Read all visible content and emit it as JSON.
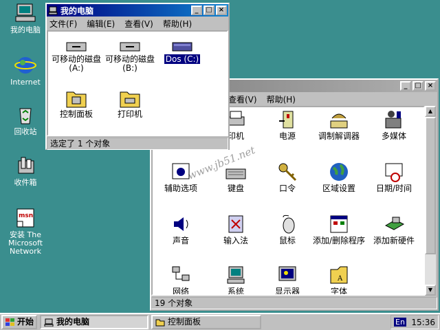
{
  "desktop": {
    "icons": [
      {
        "label": "我的电脑",
        "icon": "my-computer-icon"
      },
      {
        "label": "Internet",
        "icon": "internet-explorer-icon"
      },
      {
        "label": "回收站",
        "icon": "recycle-bin-icon"
      },
      {
        "label": "收件箱",
        "icon": "inbox-icon"
      },
      {
        "label": "安装 The Microsoft Network",
        "icon": "msn-setup-icon"
      }
    ]
  },
  "mycomputer": {
    "title": "我的电脑",
    "menu": [
      "文件(F)",
      "编辑(E)",
      "查看(V)",
      "帮助(H)"
    ],
    "items": [
      {
        "label": "可移动的磁盘 (A:)",
        "icon": "floppy-drive-icon"
      },
      {
        "label": "可移动的磁盘 (B:)",
        "icon": "floppy-drive-icon"
      },
      {
        "label": "Dos (C:)",
        "icon": "hard-drive-icon"
      },
      {
        "label": "控制面板",
        "icon": "control-panel-folder-icon"
      },
      {
        "label": "打印机",
        "icon": "printers-folder-icon"
      }
    ],
    "status": "选定了 1 个对象"
  },
  "controlpanel": {
    "menu_visible": [
      "查看(V)",
      "帮助(H)"
    ],
    "items": [
      {
        "label": "印机",
        "icon": "printers-icon"
      },
      {
        "label": "电源",
        "icon": "power-icon"
      },
      {
        "label": "调制解调器",
        "icon": "modem-icon"
      },
      {
        "label": "多媒体",
        "icon": "multimedia-icon"
      },
      {
        "label": "辅助选项",
        "icon": "accessibility-icon"
      },
      {
        "label": "键盘",
        "icon": "keyboard-icon"
      },
      {
        "label": "口令",
        "icon": "passwords-icon"
      },
      {
        "label": "区域设置",
        "icon": "regional-settings-icon"
      },
      {
        "label": "日期/时间",
        "icon": "date-time-icon"
      },
      {
        "label": "声音",
        "icon": "sounds-icon"
      },
      {
        "label": "输入法",
        "icon": "input-method-icon"
      },
      {
        "label": "鼠标",
        "icon": "mouse-icon"
      },
      {
        "label": "添加/删除程序",
        "icon": "add-remove-programs-icon"
      },
      {
        "label": "添加新硬件",
        "icon": "add-new-hardware-icon"
      },
      {
        "label": "网络",
        "icon": "network-icon"
      },
      {
        "label": "系统",
        "icon": "system-icon"
      },
      {
        "label": "显示器",
        "icon": "display-icon"
      },
      {
        "label": "字体",
        "icon": "fonts-icon"
      }
    ],
    "status": "19 个对象"
  },
  "watermark": "www.jb51.net",
  "taskbar": {
    "start": "开始",
    "buttons": [
      "我的电脑",
      "控制面板"
    ],
    "ime": "En",
    "clock": "15:36"
  }
}
